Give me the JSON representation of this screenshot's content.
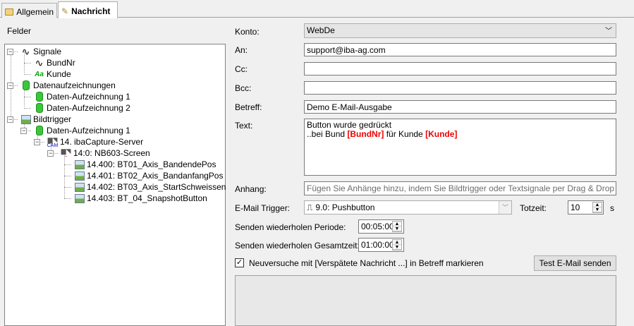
{
  "tabs": [
    {
      "label": "Allgemein"
    },
    {
      "label": "Nachricht"
    }
  ],
  "felder_label": "Felder",
  "tree": [
    {
      "label": "Signale",
      "icon": "signal-wave-icon"
    },
    {
      "label": "BundNr",
      "icon": "signal-wave-icon"
    },
    {
      "label": "Kunde",
      "icon": "text-signal-icon",
      "icon_text": "Aa"
    },
    {
      "label": "Datenaufzeichnungen",
      "icon": "data-cylinder-icon"
    },
    {
      "label": "Daten-Aufzeichnung 1",
      "icon": "data-cylinder-icon"
    },
    {
      "label": "Daten-Aufzeichnung 2",
      "icon": "data-cylinder-icon"
    },
    {
      "label": "Bildtrigger",
      "icon": "image-icon"
    },
    {
      "label": "Daten-Aufzeichnung 1",
      "icon": "data-cylinder-icon"
    },
    {
      "label": "14. ibaCapture-Server",
      "icon": "camera-icon",
      "icon_text": "CAM"
    },
    {
      "label": "14:0: NB603-Screen",
      "icon": "camera-icon"
    },
    {
      "label": "14.400: BT01_Axis_BandendePos",
      "icon": "image-icon"
    },
    {
      "label": "14.401: BT02_Axis_BandanfangPos",
      "icon": "image-icon"
    },
    {
      "label": "14.402: BT03_Axis_StartSchweissen",
      "icon": "image-icon"
    },
    {
      "label": "14.403: BT_04_SnapshotButton",
      "icon": "image-icon"
    }
  ],
  "form": {
    "konto_label": "Konto:",
    "konto_value": "WebDe",
    "an_label": "An:",
    "an_value": "support@iba-ag.com",
    "cc_label": "Cc:",
    "cc_value": "",
    "bcc_label": "Bcc:",
    "bcc_value": "",
    "betreff_label": "Betreff:",
    "betreff_value": "Demo E-Mail-Ausgabe",
    "text_label": "Text:",
    "text_line1": "Button wurde gedrückt",
    "text_line2_a": "..bei Bund ",
    "text_line2_b": "[BundNr]",
    "text_line2_c": " für Kunde ",
    "text_line2_d": "[Kunde]",
    "anhang_label": "Anhang:",
    "anhang_placeholder": "Fügen Sie Anhänge hinzu, indem Sie Bildtrigger oder Textsignale per Drag & Drop in diese Tex",
    "trigger_label": "E-Mail Trigger:",
    "trigger_value": "9.0: Pushbutton",
    "totzeit_label": "Totzeit:",
    "totzeit_value": "10",
    "totzeit_unit": "s",
    "periode_label": "Senden wiederholen Periode:",
    "periode_value": "00:05:00",
    "gesamt_label": "Senden wiederholen Gesamtzeit:",
    "gesamt_value": "01:00:00",
    "checkbox_label": "Neuversuche mit [Verspätete Nachricht ...] in Betreff markieren",
    "checkbox_checked": true,
    "test_button": "Test E-Mail senden"
  }
}
